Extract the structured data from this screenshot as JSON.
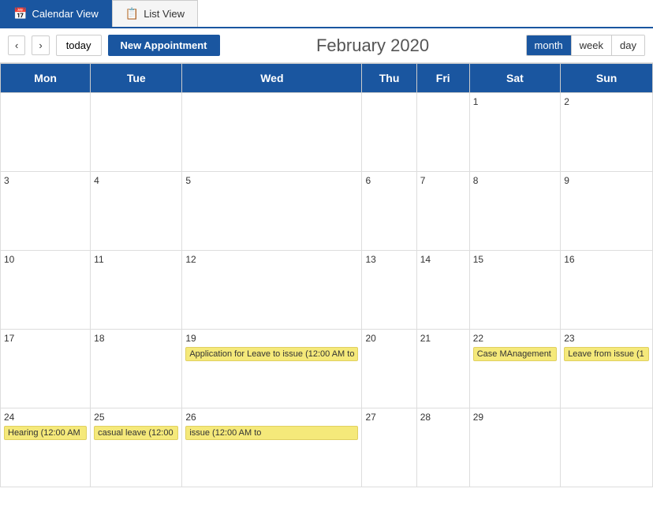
{
  "tabs": [
    {
      "id": "calendar-view",
      "label": "Calendar View",
      "icon": "📅",
      "active": true
    },
    {
      "id": "list-view",
      "label": "List View",
      "icon": "📋",
      "active": false
    }
  ],
  "toolbar": {
    "prev_label": "‹",
    "next_label": "›",
    "today_label": "today",
    "new_appt_label": "New Appointment",
    "month_title": "February 2020",
    "view_buttons": [
      {
        "id": "month",
        "label": "month",
        "active": true
      },
      {
        "id": "week",
        "label": "week",
        "active": false
      },
      {
        "id": "day",
        "label": "day",
        "active": false
      }
    ]
  },
  "calendar": {
    "headers": [
      "Mon",
      "Tue",
      "Wed",
      "Thu",
      "Fri",
      "Sat",
      "Sun"
    ],
    "weeks": [
      [
        {
          "day": "",
          "events": []
        },
        {
          "day": "",
          "events": []
        },
        {
          "day": "",
          "events": []
        },
        {
          "day": "",
          "events": []
        },
        {
          "day": "",
          "events": []
        },
        {
          "day": "1",
          "events": []
        },
        {
          "day": "2",
          "events": []
        }
      ],
      [
        {
          "day": "3",
          "events": []
        },
        {
          "day": "4",
          "events": []
        },
        {
          "day": "5",
          "events": []
        },
        {
          "day": "6",
          "events": []
        },
        {
          "day": "7",
          "events": []
        },
        {
          "day": "8",
          "events": []
        },
        {
          "day": "9",
          "events": []
        }
      ],
      [
        {
          "day": "10",
          "events": []
        },
        {
          "day": "11",
          "events": []
        },
        {
          "day": "12",
          "events": []
        },
        {
          "day": "13",
          "events": []
        },
        {
          "day": "14",
          "events": []
        },
        {
          "day": "15",
          "events": []
        },
        {
          "day": "16",
          "events": []
        }
      ],
      [
        {
          "day": "17",
          "events": []
        },
        {
          "day": "18",
          "events": []
        },
        {
          "day": "19",
          "events": [
            "Application for Leave to issue (12:00 AM to"
          ]
        },
        {
          "day": "20",
          "events": []
        },
        {
          "day": "21",
          "events": []
        },
        {
          "day": "22",
          "events": [
            "Case MAnagement"
          ]
        },
        {
          "day": "23",
          "events": [
            "Leave from issue (1"
          ]
        }
      ],
      [
        {
          "day": "24",
          "events": [
            "Hearing (12:00 AM"
          ]
        },
        {
          "day": "25",
          "events": [
            "casual leave (12:00"
          ]
        },
        {
          "day": "26",
          "events": [
            "issue (12:00 AM to"
          ]
        },
        {
          "day": "27",
          "events": []
        },
        {
          "day": "28",
          "events": []
        },
        {
          "day": "29",
          "events": []
        },
        {
          "day": "",
          "events": []
        }
      ]
    ]
  }
}
